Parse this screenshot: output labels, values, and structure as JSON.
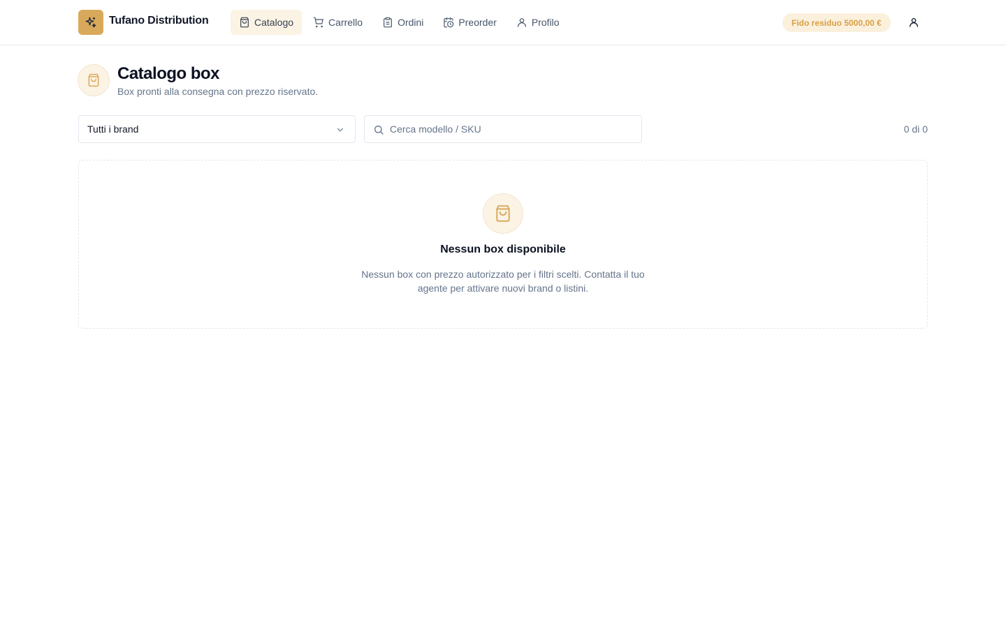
{
  "app": {
    "brand_name": "Tufano Distribution",
    "logo_icon": "sparkles-icon",
    "accent_color": "#d9a95b"
  },
  "nav": {
    "items": [
      {
        "label": "Catalogo",
        "icon": "shopping-bag-icon",
        "active": true
      },
      {
        "label": "Carrello",
        "icon": "shopping-cart-icon",
        "active": false
      },
      {
        "label": "Ordini",
        "icon": "clipboard-icon",
        "active": false
      },
      {
        "label": "Preorder",
        "icon": "calendar-clock-icon",
        "active": false
      },
      {
        "label": "Profilo",
        "icon": "user-icon",
        "active": false
      }
    ]
  },
  "header": {
    "credit_badge": "Fido residuo 5000,00 €",
    "user_menu_icon": "user-icon"
  },
  "page": {
    "title": "Catalogo box",
    "subtitle": "Box pronti alla consegna con prezzo riservato.",
    "icon": "shopping-bag-icon"
  },
  "filters": {
    "brand_select_value": "Tutti i brand",
    "search_placeholder": "Cerca modello / SKU",
    "search_value": "",
    "result_count": "0 di 0"
  },
  "empty_state": {
    "icon": "shopping-bag-icon",
    "title": "Nessun box disponibile",
    "message": "Nessun box con prezzo autorizzato per i filtri scelti. Contatta il tuo agente per attivare nuovi brand o listini."
  }
}
